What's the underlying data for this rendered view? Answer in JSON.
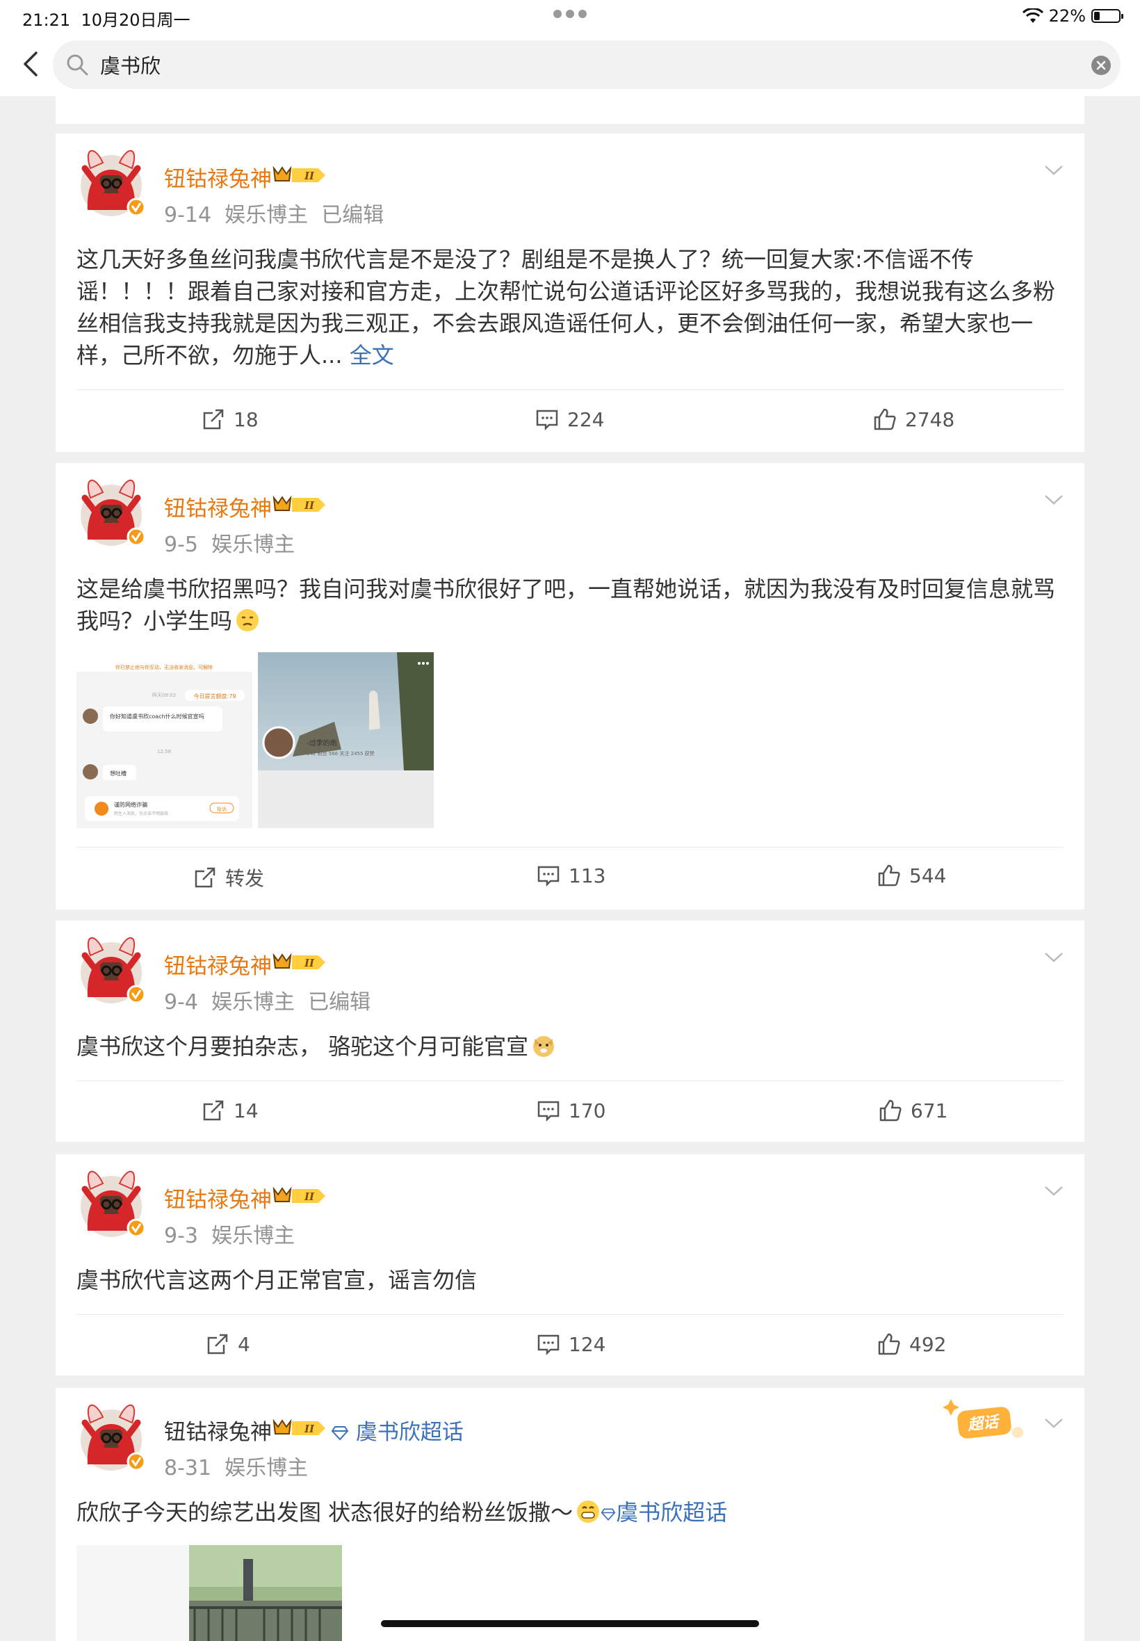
{
  "status": {
    "time": "21:21",
    "date": "10月20日周一",
    "battery": "22%"
  },
  "search": {
    "query": "虞书欣"
  },
  "colors": {
    "username": "#e8780e",
    "link": "#3a71b8",
    "meta": "#939393"
  },
  "posts": [
    {
      "user": "钮钴禄兔神",
      "date": "9-14",
      "role": "娱乐博主",
      "edited": "已编辑",
      "text": "这几天好多鱼丝问我虞书欣代言是不是没了？剧组是不是换人了？统一回复大家:不信谣不传谣！！！！跟着自己家对接和官方走，上次帮忙说句公道话评论区好多骂我的，我想说我有这么多粉丝相信我支持我就是因为我三观正，不会去跟风造谣任何人，更不会倒油任何一家，希望大家也一样，己所不欲，勿施于人...",
      "more": "全文",
      "repost": "18",
      "comments": "224",
      "likes": "2748"
    },
    {
      "user": "钮钴禄兔神",
      "date": "9-5",
      "role": "娱乐博主",
      "text": "这是给虞书欣招黑吗？我自问我对虞书欣很好了吧，一直帮她说话，就因为我没有及时回复信息就骂我吗？小学生吗",
      "repost": "转发",
      "comments": "113",
      "likes": "544",
      "img1": {
        "banner": "你已禁止他与你互动，无法收发消息。可解除",
        "time1": "昨天09:02",
        "tag": "今日提言额度:79",
        "msg1": "你好知道虞书欣coach什么时候官宣吗",
        "time2": "12:58",
        "msg2": "想吐槽",
        "warn": "谨防网络诈骗",
        "warn_sub": "陌生人消息，勿点击不明链接",
        "warn_btn": "投诉"
      },
      "img2": {
        "name": "-过李的雨",
        "stats": "142 粉丝  566 关注  2455 获赞"
      }
    },
    {
      "user": "钮钴禄兔神",
      "date": "9-4",
      "role": "娱乐博主",
      "edited": "已编辑",
      "text": "虞书欣这个月要拍杂志， 骆驼这个月可能官宣",
      "repost": "14",
      "comments": "170",
      "likes": "671"
    },
    {
      "user": "钮钴禄兔神",
      "date": "9-3",
      "role": "娱乐博主",
      "text": "虞书欣代言这两个月正常官宣，谣言勿信",
      "repost": "4",
      "comments": "124",
      "likes": "492"
    },
    {
      "user": "钮钴禄兔神",
      "topic": "虞书欣超话",
      "date": "8-31",
      "role": "娱乐博主",
      "text": "欣欣子今天的综艺出发图 状态很好的给粉丝饭撒～",
      "topic_link": "虞书欣超话",
      "badge": "超话"
    }
  ]
}
